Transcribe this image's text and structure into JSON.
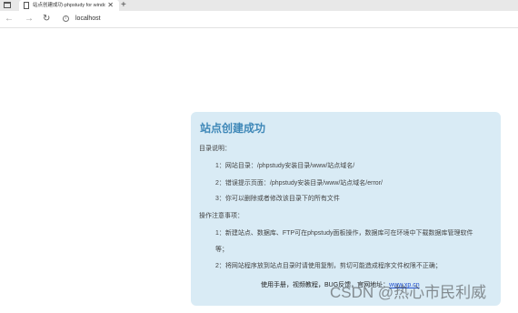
{
  "browser": {
    "tab_title": "站点创建成功-phpstudy for windows",
    "tab_close": "✕",
    "new_tab": "+",
    "nav_back": "←",
    "nav_forward": "→",
    "nav_reload": "↻",
    "info_glyph": "i",
    "address": "localhost"
  },
  "card": {
    "title": "站点创建成功",
    "dir_heading": "目录说明：",
    "items": [
      "1：网站目录：/phpstudy安装目录/www/站点域名/",
      "2：错误提示页面：/phpstudy安装目录/www/站点域名/error/",
      "3：你可以删除或者修改该目录下的所有文件"
    ],
    "notes_heading": "操作注意事项：",
    "notes": [
      "1：新建站点、数据库、FTP可在phpstudy面板操作，数据库可在环境中下载数据库管理软件",
      "等；",
      "2：将网站程序放到站点目录时请使用复制，剪切可能造成程序文件权限不正确；"
    ],
    "footer_text": "使用手册，视频教程，BUG反馈，官网地址：",
    "footer_link": "www.xp.cn"
  },
  "watermark": "CSDN @热心市民利威",
  "colors": {
    "card_bg": "#d9ebf5",
    "title": "#3f88b8",
    "link": "#1f4fd0"
  }
}
